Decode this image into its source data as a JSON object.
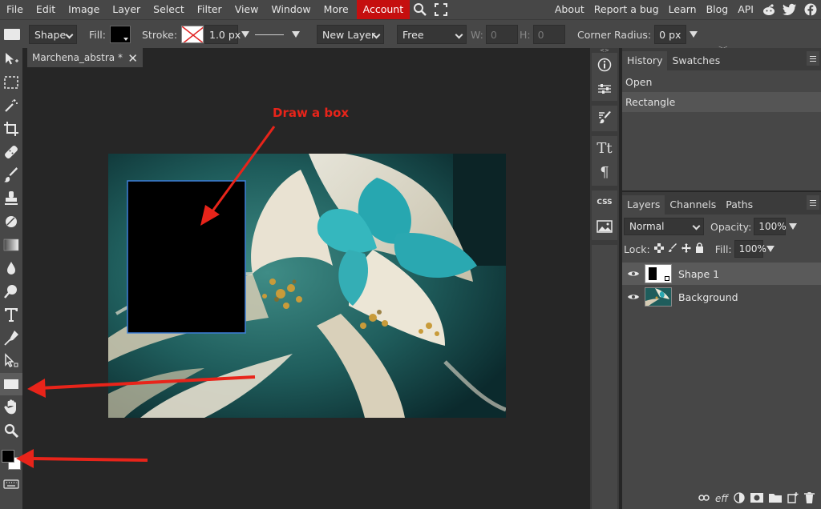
{
  "menu": {
    "items": [
      "File",
      "Edit",
      "Image",
      "Layer",
      "Select",
      "Filter",
      "View",
      "Window",
      "More"
    ],
    "account": "Account",
    "right_links": [
      "About",
      "Report a bug",
      "Learn",
      "Blog",
      "API"
    ]
  },
  "options": {
    "shape_label": "Shape",
    "fill_label": "Fill:",
    "stroke_label": "Stroke:",
    "stroke_width": "1.0 px",
    "layer_mode": "New Layer",
    "size_mode": "Free",
    "w_label": "W:",
    "w_value": "0",
    "h_label": "H:",
    "h_value": "0",
    "corner_label": "Corner Radius:",
    "corner_value": "0 px"
  },
  "document": {
    "tab_title": "Marchena_abstra *",
    "annotation": "Draw a box"
  },
  "history": {
    "tabs": [
      "History",
      "Swatches"
    ],
    "items": [
      "Open",
      "Rectangle"
    ]
  },
  "layers": {
    "tabs": [
      "Layers",
      "Channels",
      "Paths"
    ],
    "blend_mode": "Normal",
    "opacity_label": "Opacity:",
    "opacity_value": "100%",
    "lock_label": "Lock:",
    "fill_label": "Fill:",
    "fill_value": "100%",
    "items": [
      "Shape 1",
      "Background"
    ],
    "footer_eff": "eff"
  },
  "colors": {
    "accent": "#c50f0f",
    "annotation_red": "#e8241a",
    "shape_fill": "#000000",
    "selection_blue": "#3d7fd9"
  }
}
